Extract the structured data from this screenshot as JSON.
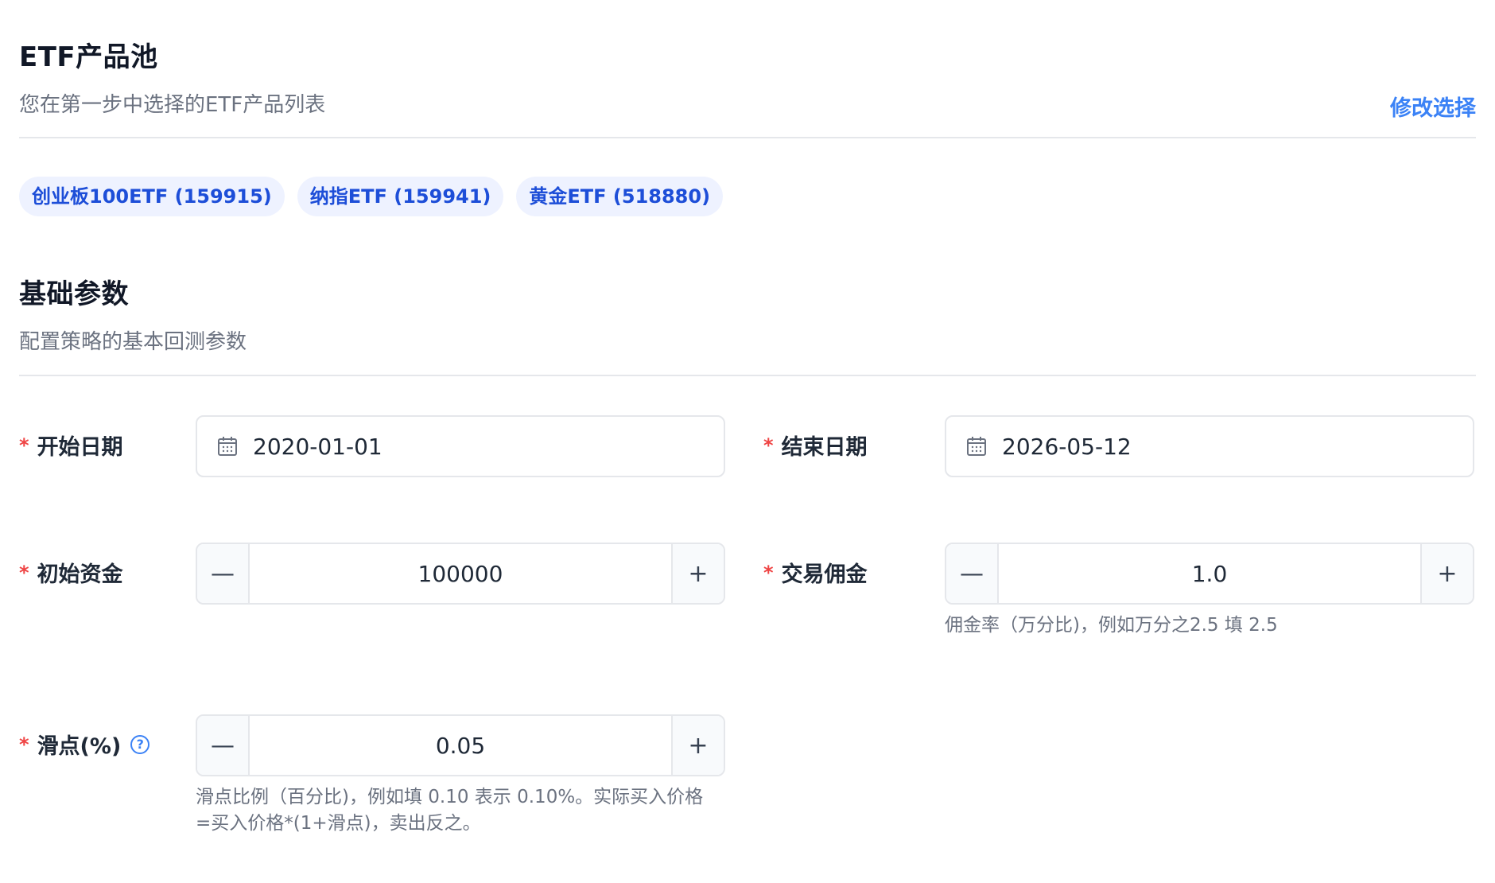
{
  "etf_pool": {
    "title": "ETF产品池",
    "subtitle": "您在第一步中选择的ETF产品列表",
    "edit_label": "修改选择",
    "chips": [
      "创业板100ETF (159915)",
      "纳指ETF (159941)",
      "黄金ETF (518880)"
    ]
  },
  "basic": {
    "title": "基础参数",
    "subtitle": "配置策略的基本回测参数",
    "required_mark": "*",
    "start_date": {
      "label": "开始日期",
      "value": "2020-01-01",
      "icon": "calendar-icon"
    },
    "end_date": {
      "label": "结束日期",
      "value": "2026-05-12",
      "icon": "calendar-icon"
    },
    "initial_capital": {
      "label": "初始资金",
      "value": "100000",
      "minus": "—",
      "plus": "+"
    },
    "commission": {
      "label": "交易佣金",
      "value": "1.0",
      "minus": "—",
      "plus": "+",
      "hint": "佣金率（万分比)，例如万分之2.5 填 2.5"
    },
    "slippage": {
      "label": "滑点(%)",
      "help_icon": "?",
      "value": "0.05",
      "minus": "—",
      "plus": "+",
      "hint_line1": "滑点比例（百分比)，例如填 0.10 表示 0.10%。实际买入价格",
      "hint_line2": "=买入价格*(1+滑点)，卖出反之。"
    }
  },
  "colors": {
    "accent": "#3b82f6",
    "chip_bg": "#eef2ff",
    "chip_text": "#1d4ed8",
    "required": "#ef4444"
  }
}
